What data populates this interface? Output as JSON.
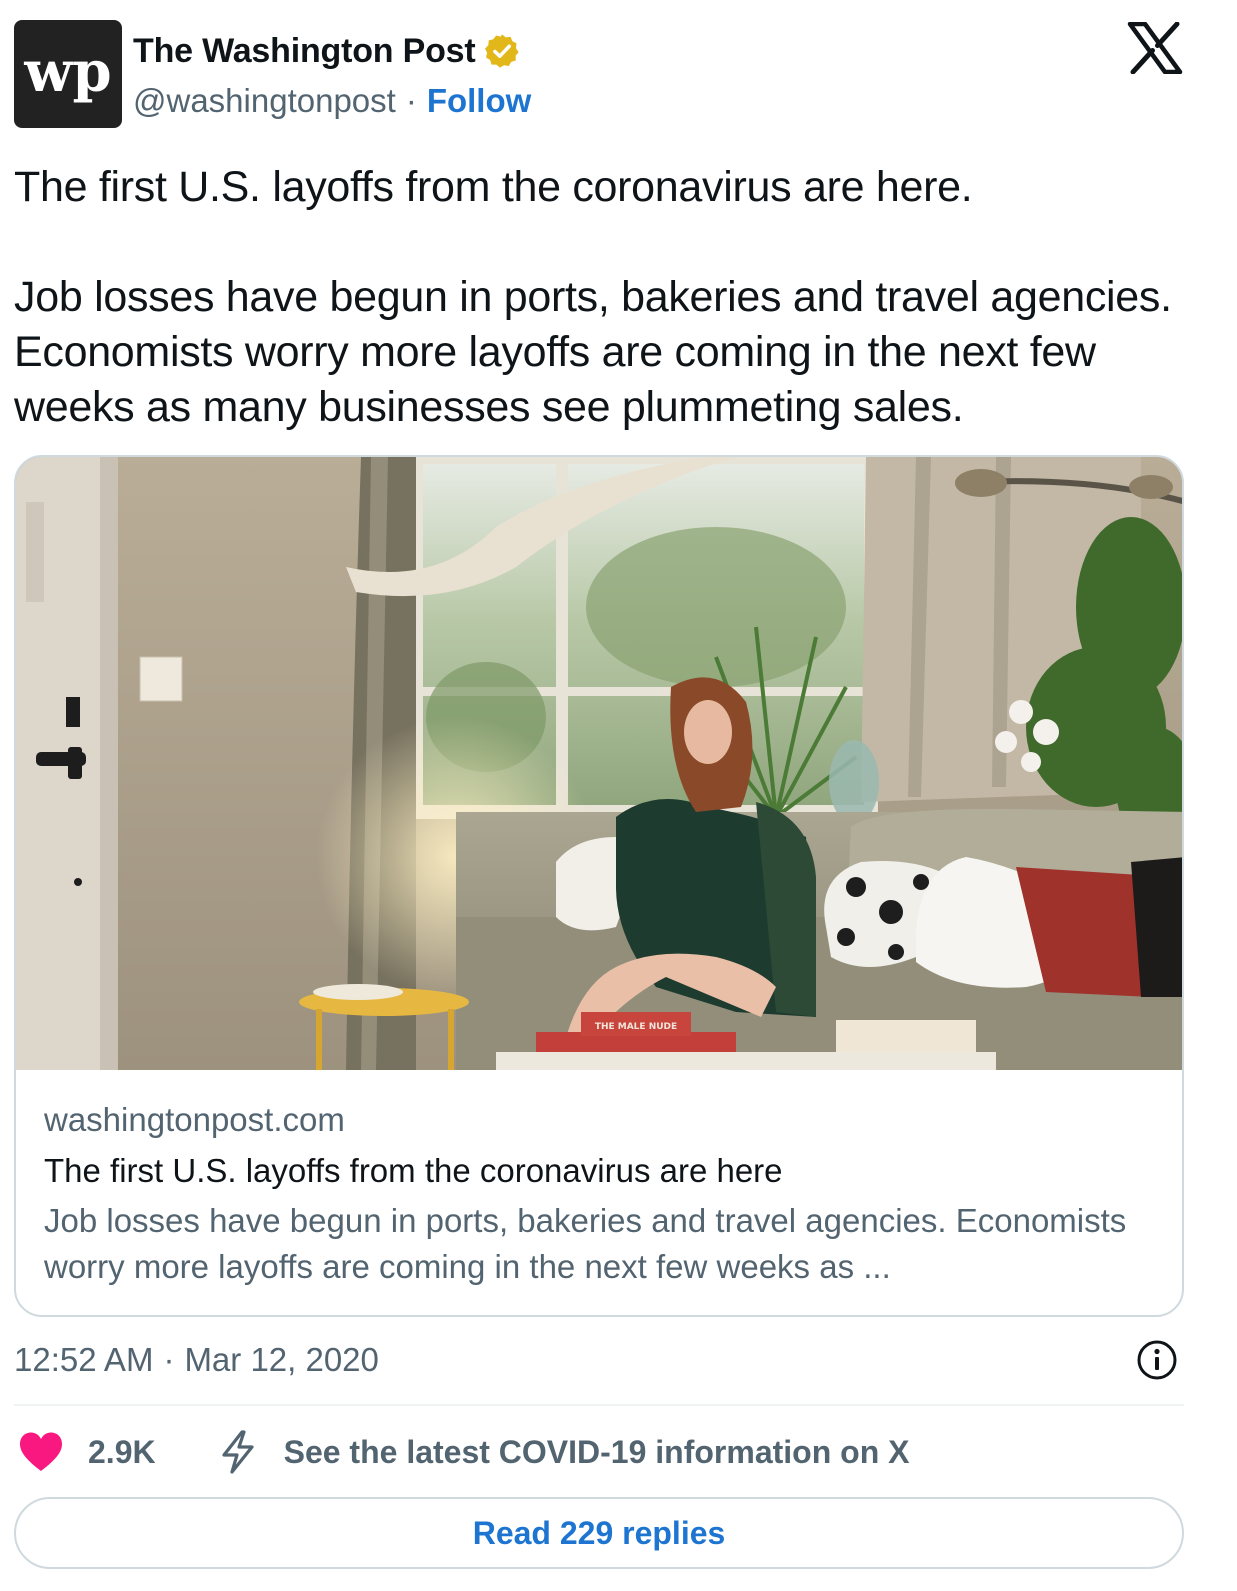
{
  "author": {
    "display_name": "The Washington Post",
    "handle": "@washingtonpost",
    "separator": "·",
    "follow_label": "Follow",
    "logo_text": "wp",
    "verified_color": "#e2b719",
    "avatar_bg": "#222222"
  },
  "tweet": {
    "paragraph_1": "The first U.S. layoffs from the coronavirus are here.",
    "paragraph_2": "Job losses have begun in ports, bakeries and travel agencies. Economists worry more layoffs are coming in the next few weeks as many businesses see plummeting sales."
  },
  "card": {
    "book_title": "THE MALE NUDE",
    "domain": "washingtonpost.com",
    "title": "The first U.S. layoffs from the coronavirus are here",
    "description": "Job losses have begun in ports, bakeries and travel agencies. Economists worry more layoffs are coming in the next few weeks as ..."
  },
  "meta": {
    "time": "12:52 AM",
    "separator": "·",
    "date": "Mar 12, 2020"
  },
  "actions": {
    "like_count": "2.9K",
    "covid_link": "See the latest COVID-19 information on X",
    "read_replies": "Read 229 replies"
  },
  "colors": {
    "link_blue": "#1d75d1",
    "heart_pink": "#f91880",
    "secondary_text": "#536471",
    "border": "#cfd9de"
  },
  "icons": [
    "x-logo-icon",
    "verified-badge-icon",
    "info-icon",
    "heart-icon",
    "bolt-icon"
  ]
}
